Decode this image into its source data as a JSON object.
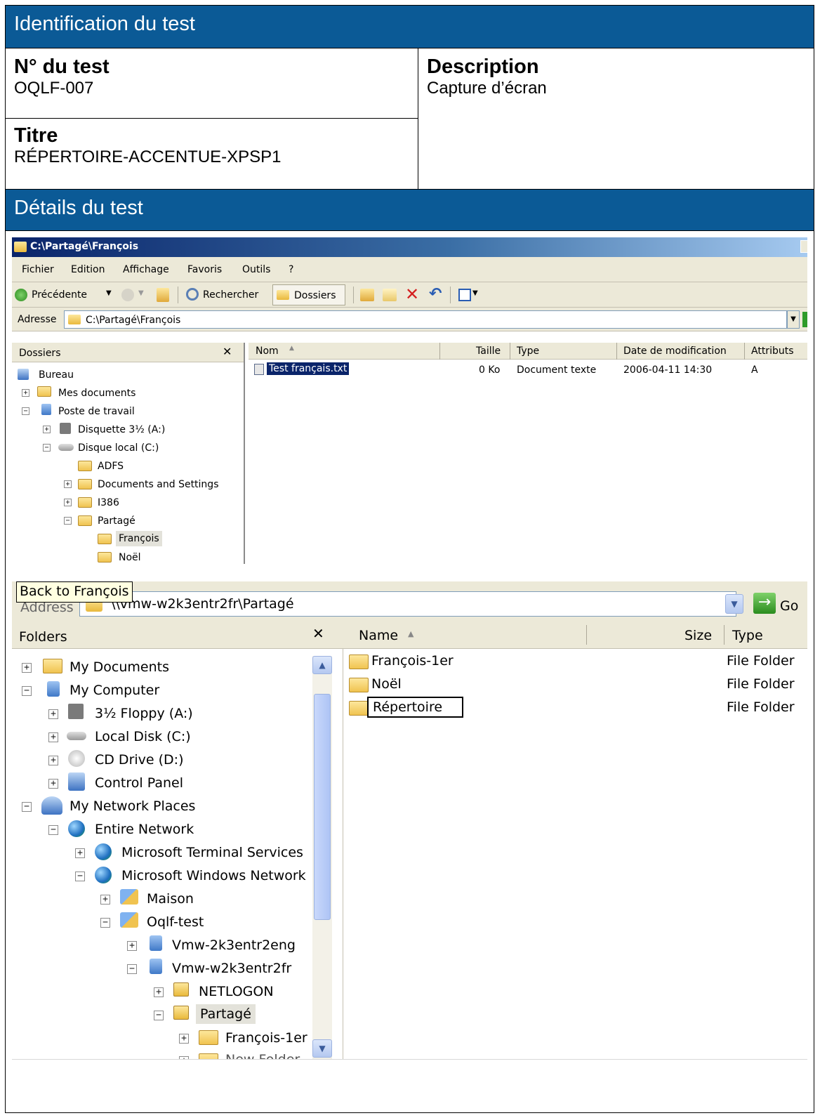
{
  "header": {
    "identification": "Identification du test",
    "details": "Détails du test"
  },
  "test": {
    "number_label": "N° du test",
    "number": "OQLF-007",
    "title_label": "Titre",
    "title": "RÉPERTOIRE-ACCENTUE-XPSP1",
    "description_label": "Description",
    "description": "Capture d’écran"
  },
  "shot1": {
    "window_title": "C:\\Partagé\\François",
    "menu": [
      "Fichier",
      "Edition",
      "Affichage",
      "Favoris",
      "Outils",
      "?"
    ],
    "toolbar": {
      "back": "Précédente",
      "search": "Rechercher",
      "folders": "Dossiers"
    },
    "address_label": "Adresse",
    "address": "C:\\Partagé\\François",
    "folders_title": "Dossiers",
    "close": "✕",
    "tree": [
      "Bureau",
      "Mes documents",
      "Poste de travail",
      "Disquette 3½ (A:)",
      "Disque local (C:)",
      "ADFS",
      "Documents and Settings",
      "I386",
      "Partagé",
      "François",
      "Noël"
    ],
    "columns": [
      "Nom",
      "Taille",
      "Type",
      "Date de modification",
      "Attributs"
    ],
    "file": {
      "name": "Test français.txt",
      "size": "0 Ko",
      "type": "Document texte",
      "date": "2006-04-11 14:30",
      "attr": "A"
    }
  },
  "shot2": {
    "tooltip": "Back to François",
    "address_label": "Address",
    "address": "\\\\vmw-w2k3entr2fr\\Partagé",
    "go": "Go",
    "folders_title": "Folders",
    "close": "✕",
    "tree": [
      "My Documents",
      "My Computer",
      "3½ Floppy (A:)",
      "Local Disk (C:)",
      "CD Drive (D:)",
      "Control Panel",
      "My Network Places",
      "Entire Network",
      "Microsoft Terminal Services",
      "Microsoft Windows Network",
      "Maison",
      "Oqlf-test",
      "Vmw-2k3entr2eng",
      "Vmw-w2k3entr2fr",
      "NETLOGON",
      "Partagé",
      "François-1er",
      "New Folder"
    ],
    "columns": [
      "Name",
      "Size",
      "Type"
    ],
    "files": [
      {
        "name": "François-1er",
        "type": "File Folder"
      },
      {
        "name": "Noël",
        "type": "File Folder"
      },
      {
        "name": "Répertoire",
        "type": "File Folder"
      }
    ]
  },
  "colors": {
    "band": "#0b5a96",
    "xp_title": "#0a246a",
    "xp_face": "#ece9d8"
  }
}
